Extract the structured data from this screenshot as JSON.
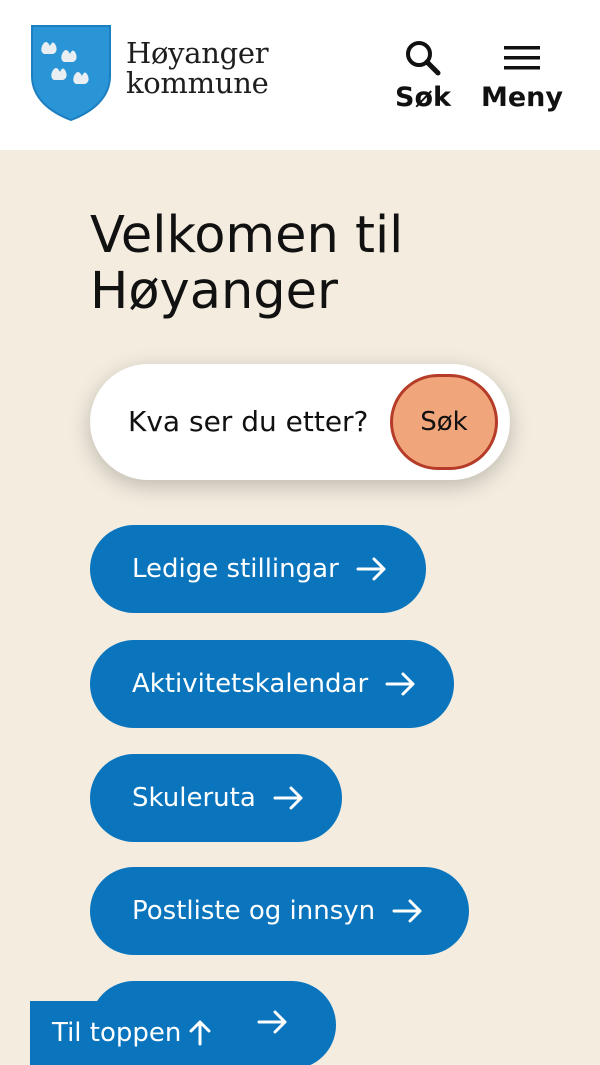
{
  "header": {
    "logo_line1": "Høyanger",
    "logo_line2": "kommune",
    "search_label": "Søk",
    "menu_label": "Meny"
  },
  "hero": {
    "title": "Velkomen til Høyanger"
  },
  "search": {
    "placeholder": "Kva ser du etter?",
    "button_label": "Søk"
  },
  "links": [
    {
      "label": "Ledige stillingar"
    },
    {
      "label": "Aktivitetskalendar"
    },
    {
      "label": "Skuleruta"
    },
    {
      "label": "Postliste og innsyn"
    },
    {
      "label": ""
    }
  ],
  "back_to_top": {
    "label": "Til toppen"
  },
  "colors": {
    "background": "#f3ecdf",
    "primary_blue": "#0a74bd",
    "search_button": "#f0a57a",
    "search_button_border": "#b53c28"
  },
  "icons": {
    "logo": "coat-of-arms-icon",
    "search": "search-icon",
    "menu": "hamburger-menu-icon",
    "arrow": "arrow-right-icon",
    "to_top": "arrow-up-icon"
  }
}
